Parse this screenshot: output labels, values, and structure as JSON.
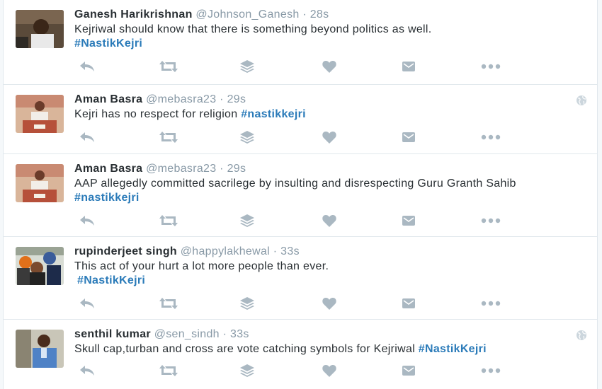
{
  "tweets": [
    {
      "fullname": "Ganesh Harikrishnan",
      "username": "@Johnson_Ganesh",
      "dot": "·",
      "time": "28s",
      "text": "Kejriwal should know that there is something beyond politics as well.",
      "hashtag": "#NastikKejri",
      "avatar": "avatar-ganesh",
      "show_globe": false
    },
    {
      "fullname": "Aman Basra",
      "username": "@mebasra23",
      "dot": "·",
      "time": "29s",
      "text": "Kejri has no respect for religion",
      "hashtag": "#nastikkejri",
      "avatar": "avatar-aman",
      "show_globe": true
    },
    {
      "fullname": "Aman Basra",
      "username": "@mebasra23",
      "dot": "·",
      "time": "29s",
      "text": "AAP allegedly committed sacrilege by insulting and disrespecting Guru Granth Sahib",
      "hashtag": "#nastikkejri",
      "avatar": "avatar-aman",
      "show_globe": false
    },
    {
      "fullname": "rupinderjeet singh",
      "username": "@happylakhewal",
      "dot": "·",
      "time": "33s",
      "text": "This act of your hurt a lot more people than ever.",
      "hashtag": "#NastikKejri",
      "avatar": "avatar-rupinderjeet",
      "show_globe": false
    },
    {
      "fullname": "senthil kumar",
      "username": "@sen_sindh",
      "dot": "·",
      "time": "33s",
      "text": "Skull cap,turban and cross are vote catching symbols for Kejriwal",
      "hashtag": "#NastikKejri",
      "avatar": "avatar-senthil",
      "show_globe": true
    }
  ],
  "action_icons": [
    "reply-icon",
    "retweet-icon",
    "buffer-icon",
    "like-icon",
    "dm-icon",
    "more-icon"
  ],
  "colors": {
    "hashtag": "#2b7bb9",
    "action_icon": "#aab8c2",
    "muted": "#8899a6",
    "border": "#e1e8ed"
  }
}
